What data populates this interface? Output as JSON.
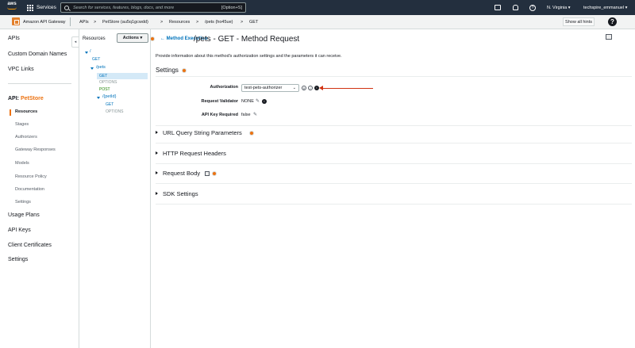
{
  "topnav": {
    "logo_text": "aws",
    "services_label": "Services",
    "search_placeholder": "Search for services, features, blogs, docs, and more",
    "search_shortcut": "[Option+S]",
    "region": "N. Virginia",
    "account": "techspire_emmanuel"
  },
  "subbar": {
    "service_name": "Amazon API Gateway",
    "breadcrumbs": [
      "APIs",
      "PetStore (au5q1gcwdd)",
      "Resources",
      "/pets (ho45ue)",
      "GET"
    ],
    "separator": ">",
    "hints_button": "Show all hints",
    "help_label": "?"
  },
  "leftnav": {
    "top_items": [
      "APIs",
      "Custom Domain Names",
      "VPC Links"
    ],
    "api_prefix": "API:",
    "api_name": "PetStore",
    "sub_items": [
      "Resources",
      "Stages",
      "Authorizers",
      "Gateway Responses",
      "Models",
      "Resource Policy",
      "Documentation",
      "Settings"
    ],
    "bottom_items": [
      "Usage Plans",
      "API Keys",
      "Client Certificates",
      "Settings"
    ],
    "collapse_glyph": "◂"
  },
  "resources": {
    "header": "Resources",
    "actions_label": "Actions",
    "tree": {
      "root": "/",
      "root_get": "GET",
      "pets": "/pets",
      "pets_get": "GET",
      "pets_options": "OPTIONS",
      "pets_post": "POST",
      "petid": "/{petId}",
      "petid_get": "GET",
      "petid_options": "OPTIONS"
    }
  },
  "main": {
    "back_link": "Method Execution",
    "title": "/pets - GET - Method Request",
    "description": "Provide information about this method's authorization settings and the parameters it can receive.",
    "settings_heading": "Settings",
    "fields": {
      "authorization_label": "Authorization",
      "authorization_value": "test-pets-authorizer",
      "validator_label": "Request Validator",
      "validator_value": "NONE",
      "apikey_label": "API Key Required",
      "apikey_value": "false"
    },
    "sections": [
      "URL Query String Parameters",
      "HTTP Request Headers",
      "Request Body",
      "SDK Settings"
    ]
  },
  "colors": {
    "nav_bg": "#232f3e",
    "accent": "#ec7211",
    "link": "#0073bb",
    "arrow": "#d13212"
  }
}
